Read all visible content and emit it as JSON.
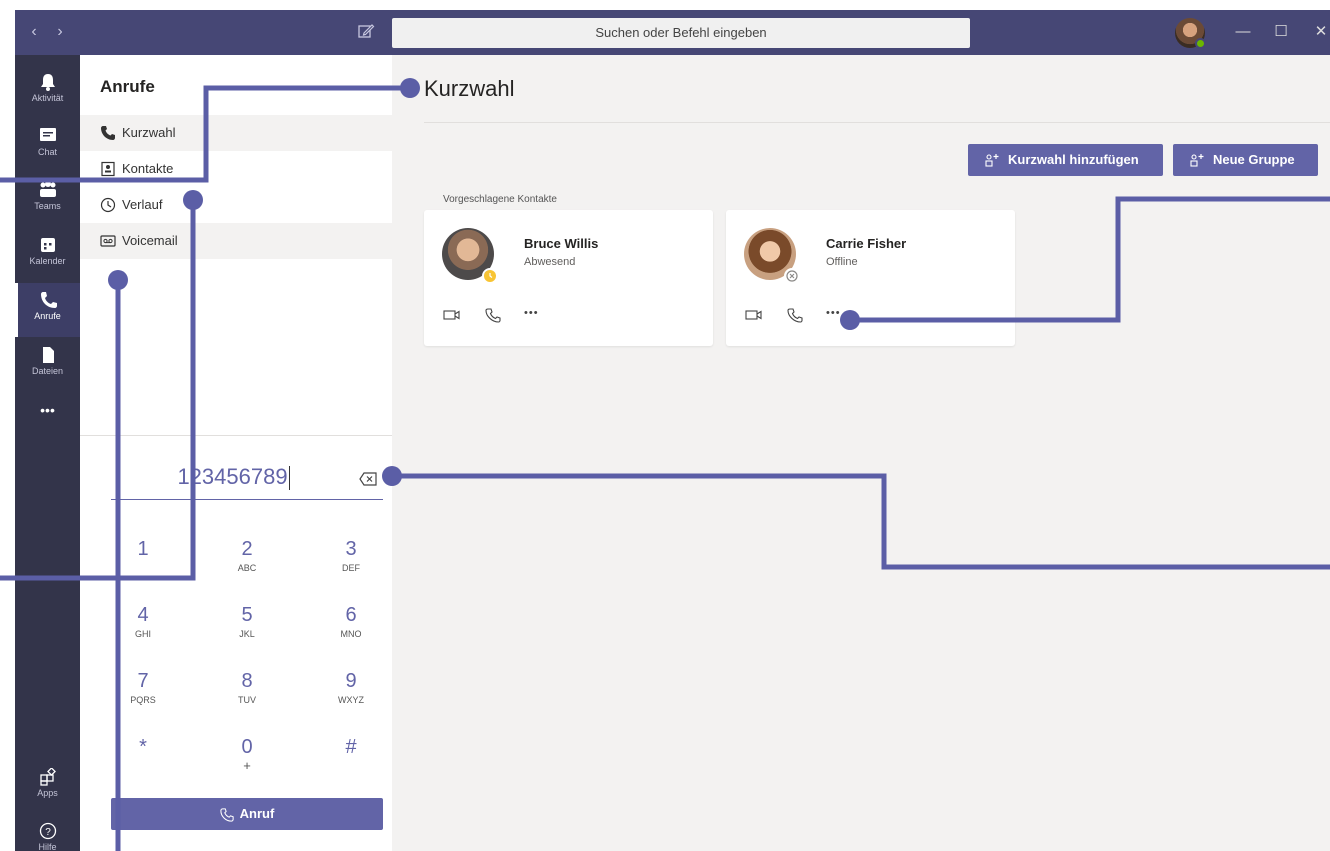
{
  "titlebar": {
    "search_placeholder": "Suchen oder Befehl eingeben",
    "back": "‹",
    "forward": "›",
    "minimize": "—",
    "maximize": "☐",
    "close": "✕"
  },
  "appbar": {
    "items": [
      {
        "label": "Aktivität",
        "icon": "bell-icon"
      },
      {
        "label": "Chat",
        "icon": "chat-icon"
      },
      {
        "label": "Teams",
        "icon": "teams-icon"
      },
      {
        "label": "Kalender",
        "icon": "calendar-icon"
      },
      {
        "label": "Anrufe",
        "icon": "phone-icon",
        "active": true
      },
      {
        "label": "Dateien",
        "icon": "file-icon"
      }
    ],
    "more": "•••",
    "apps_label": "Apps",
    "help_label": "Hilfe"
  },
  "calls": {
    "title": "Anrufe",
    "nav": [
      {
        "label": "Kurzwahl",
        "icon": "phone-icon",
        "active": true
      },
      {
        "label": "Kontakte",
        "icon": "contacts-icon"
      },
      {
        "label": "Verlauf",
        "icon": "clock-icon"
      },
      {
        "label": "Voicemail",
        "icon": "voicemail-icon"
      }
    ],
    "dial_value": "123456789",
    "keys": [
      {
        "d": "1",
        "l": ""
      },
      {
        "d": "2",
        "l": "ABC"
      },
      {
        "d": "3",
        "l": "DEF"
      },
      {
        "d": "4",
        "l": "GHI"
      },
      {
        "d": "5",
        "l": "JKL"
      },
      {
        "d": "6",
        "l": "MNO"
      },
      {
        "d": "7",
        "l": "PQRS"
      },
      {
        "d": "8",
        "l": "TUV"
      },
      {
        "d": "9",
        "l": "WXYZ"
      },
      {
        "d": "*",
        "l": ""
      },
      {
        "d": "0",
        "l": "+"
      },
      {
        "d": "#",
        "l": ""
      }
    ],
    "call_button": "Anruf"
  },
  "main": {
    "title": "Kurzwahl",
    "add_speed_dial": "Kurzwahl hinzufügen",
    "new_group": "Neue Gruppe",
    "suggested_label": "Vorgeschlagene Kontakte",
    "contacts": [
      {
        "name": "Bruce Willis",
        "presence": "Abwesend",
        "status_color": "#f8c433"
      },
      {
        "name": "Carrie Fisher",
        "presence": "Offline",
        "status_color": "#ffffff"
      }
    ],
    "more": "•••"
  },
  "colors": {
    "accent": "#6264a7",
    "titlebar": "#464775",
    "appbar": "#33344a",
    "callout": "#5b5ea6"
  }
}
